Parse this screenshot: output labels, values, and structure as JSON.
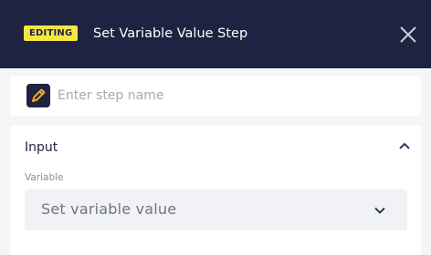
{
  "header": {
    "badge": "EDITING",
    "title": "Set Variable Value Step",
    "background": "#1d2340",
    "badge_color": "#f5e642"
  },
  "step_name": {
    "value": "",
    "placeholder": "Enter step name",
    "icon": "pencil-icon"
  },
  "section": {
    "title": "Input",
    "collapse_icon": "chevron-up-icon",
    "field": {
      "label": "Variable",
      "value": "Set variable value",
      "dropdown_icon": "chevron-down-icon"
    }
  }
}
